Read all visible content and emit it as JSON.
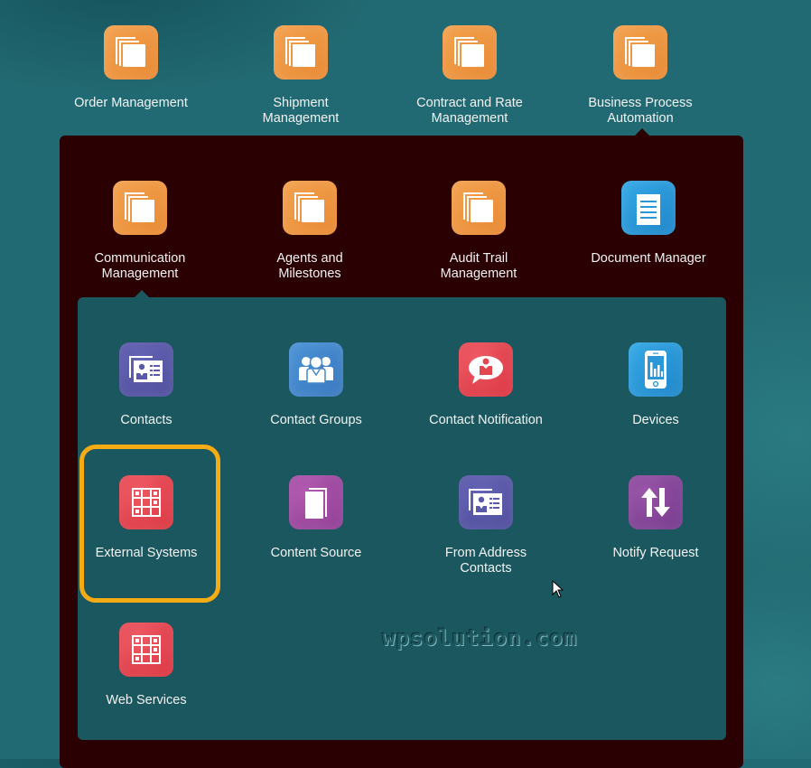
{
  "top_row": [
    {
      "label": "Order Management",
      "icon": "stacked-pages-icon",
      "color": "#ef9540"
    },
    {
      "label": "Shipment\nManagement",
      "icon": "stacked-pages-icon",
      "color": "#ef9540"
    },
    {
      "label": "Contract and Rate\nManagement",
      "icon": "stacked-pages-icon",
      "color": "#ef9540"
    },
    {
      "label": "Business Process\nAutomation",
      "icon": "stacked-pages-icon",
      "color": "#ef9540",
      "expanded": true
    }
  ],
  "second_row": [
    {
      "label": "Communication\nManagement",
      "icon": "stacked-pages-icon",
      "color": "#ef9540",
      "expanded": true
    },
    {
      "label": "Agents and\nMilestones",
      "icon": "stacked-pages-icon",
      "color": "#ef9540"
    },
    {
      "label": "Audit Trail\nManagement",
      "icon": "stacked-pages-icon",
      "color": "#ef9540"
    },
    {
      "label": "Document Manager",
      "icon": "document-icon",
      "color": "#2a98d8"
    }
  ],
  "communication_items": [
    {
      "label": "Contacts",
      "icon": "contact-card-icon",
      "color": "#5a59a9"
    },
    {
      "label": "Contact Groups",
      "icon": "people-group-icon",
      "color": "#4487cc"
    },
    {
      "label": "Contact Notification",
      "icon": "speech-bubble-person-icon",
      "color": "#e44650"
    },
    {
      "label": "Devices",
      "icon": "mobile-chart-icon",
      "color": "#2a98d8"
    },
    {
      "label": "External Systems",
      "icon": "grid-icon",
      "color": "#e44650",
      "highlighted": true
    },
    {
      "label": "Content Source",
      "icon": "pages-icon",
      "color": "#a24ba2"
    },
    {
      "label": "From Address\nContacts",
      "icon": "contact-card-icon",
      "color": "#5a59a9"
    },
    {
      "label": "Notify Request",
      "icon": "up-down-arrows-icon",
      "color": "#85479a"
    },
    {
      "label": "Web Services",
      "icon": "grid-icon",
      "color": "#e44650"
    }
  ],
  "highlight_color": "#f4ab14",
  "watermark": "wpsolution.com"
}
